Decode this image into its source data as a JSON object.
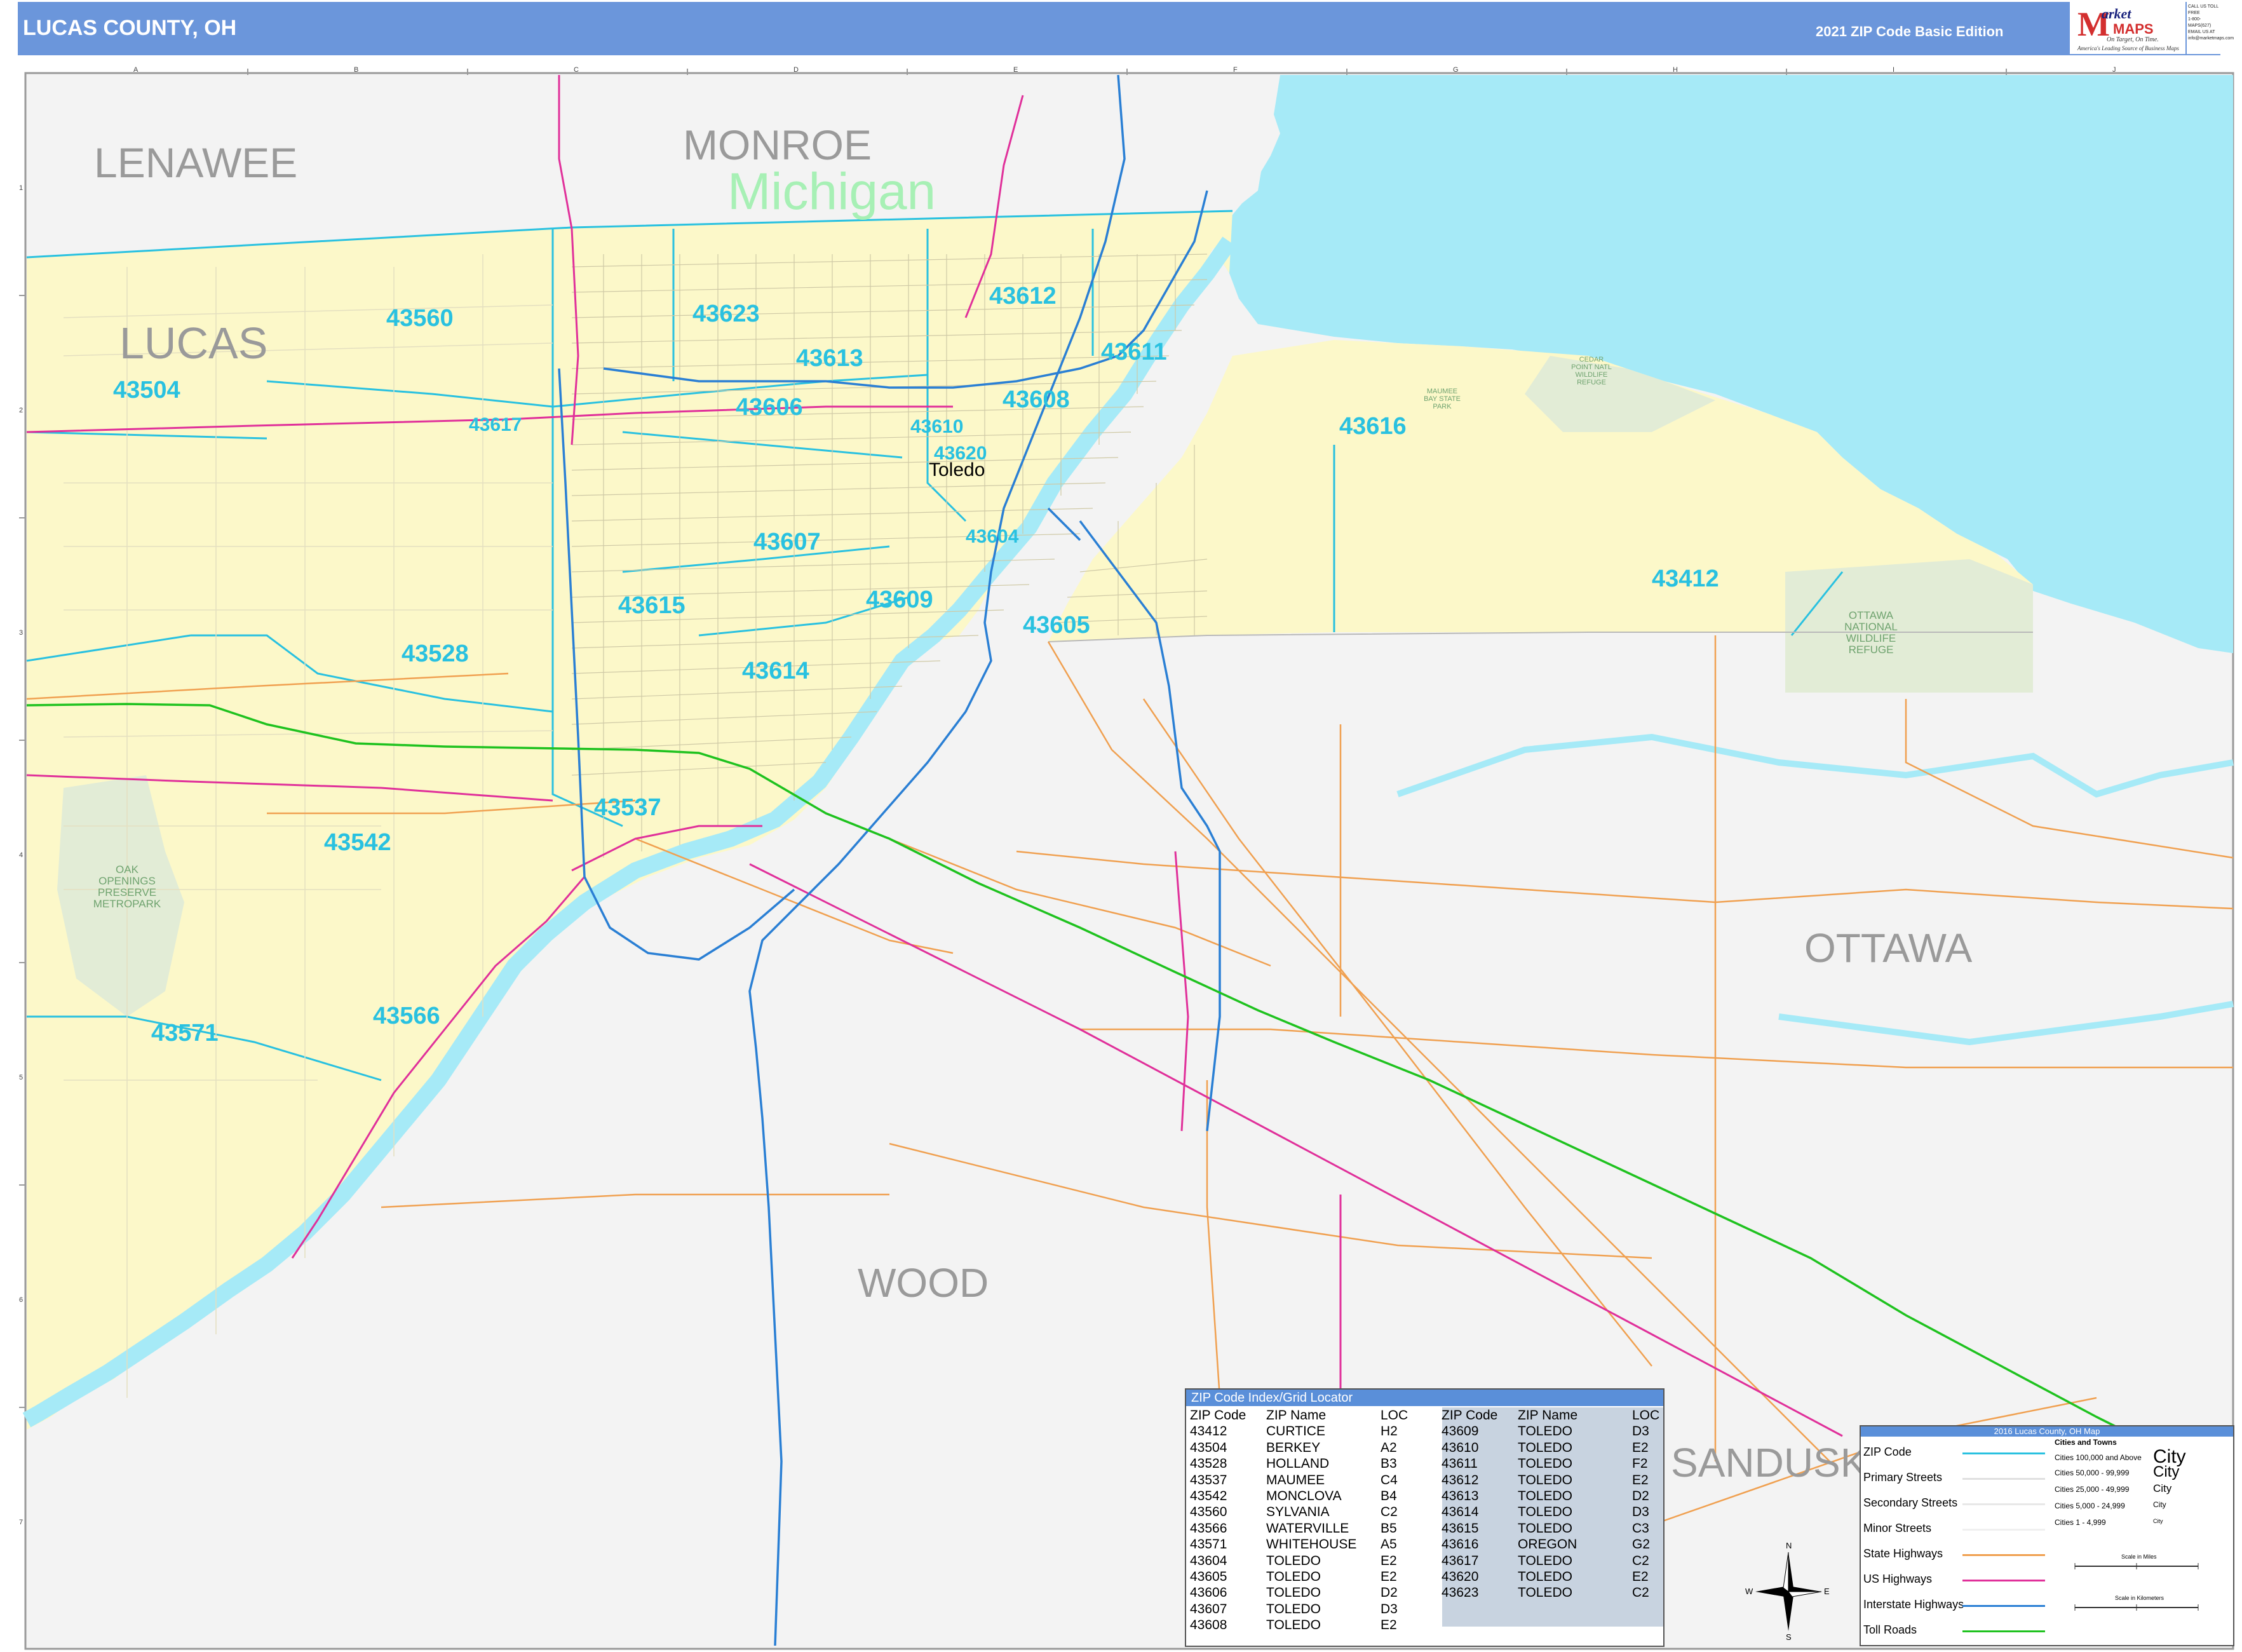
{
  "header": {
    "title": "LUCAS COUNTY, OH",
    "edition": "2021 ZIP Code Basic Edition",
    "logo": {
      "m": "M",
      "top": "arket",
      "maps": "MAPS",
      "tagline1": "On Target, On Time.",
      "tagline2": "America's Leading Source of Business Maps"
    },
    "contact": [
      "CALL US TOLL FREE",
      "1-800-MAPS(627)",
      "EMAIL US AT",
      "info@marketmaps.com"
    ]
  },
  "grid": {
    "columns": [
      "A",
      "B",
      "C",
      "D",
      "E",
      "F",
      "G",
      "H",
      "I",
      "J"
    ],
    "rows": [
      "1",
      "2",
      "3",
      "4",
      "5",
      "6",
      "7"
    ]
  },
  "counties": {
    "lenawee": "LENAWEE",
    "monroe": "MONROE",
    "lucas": "LUCAS",
    "ottawa": "OTTAWA",
    "wood": "WOOD",
    "sandusky": "SANDUSK"
  },
  "state_label": "Michigan",
  "city_label": "Toledo",
  "zip_labels": {
    "z43560": "43560",
    "z43623": "43623",
    "z43612": "43612",
    "z43613": "43613",
    "z43611": "43611",
    "z43504": "43504",
    "z43606": "43606",
    "z43608": "43608",
    "z43617": "43617",
    "z43610": "43610",
    "z43616": "43616",
    "z43620": "43620",
    "z43607": "43607",
    "z43604": "43604",
    "z43412": "43412",
    "z43615": "43615",
    "z43609": "43609",
    "z43605": "43605",
    "z43528": "43528",
    "z43614": "43614",
    "z43537": "43537",
    "z43542": "43542",
    "z43571": "43571",
    "z43566": "43566"
  },
  "parks": {
    "oak_openings": "OAK OPENINGS PRESERVE METROPARK",
    "ottawa_nwr": "OTTAWA NATIONAL WILDLIFE REFUGE",
    "maumee_bay": "MAUMEE BAY STATE PARK",
    "cedar_point": "CEDAR POINT NATL WILDLIFE REFUGE"
  },
  "index": {
    "title": "ZIP Code Index/Grid Locator",
    "headers": {
      "zip": "ZIP Code",
      "name": "ZIP Name",
      "loc": "LOC"
    },
    "left": [
      {
        "zip": "43412",
        "name": "CURTICE",
        "loc": "H2"
      },
      {
        "zip": "43504",
        "name": "BERKEY",
        "loc": "A2"
      },
      {
        "zip": "43528",
        "name": "HOLLAND",
        "loc": "B3"
      },
      {
        "zip": "43537",
        "name": "MAUMEE",
        "loc": "C4"
      },
      {
        "zip": "43542",
        "name": "MONCLOVA",
        "loc": "B4"
      },
      {
        "zip": "43560",
        "name": "SYLVANIA",
        "loc": "C2"
      },
      {
        "zip": "43566",
        "name": "WATERVILLE",
        "loc": "B5"
      },
      {
        "zip": "43571",
        "name": "WHITEHOUSE",
        "loc": "A5"
      },
      {
        "zip": "43604",
        "name": "TOLEDO",
        "loc": "E2"
      },
      {
        "zip": "43605",
        "name": "TOLEDO",
        "loc": "E2"
      },
      {
        "zip": "43606",
        "name": "TOLEDO",
        "loc": "D2"
      },
      {
        "zip": "43607",
        "name": "TOLEDO",
        "loc": "D3"
      },
      {
        "zip": "43608",
        "name": "TOLEDO",
        "loc": "E2"
      }
    ],
    "right": [
      {
        "zip": "43609",
        "name": "TOLEDO",
        "loc": "D3"
      },
      {
        "zip": "43610",
        "name": "TOLEDO",
        "loc": "E2"
      },
      {
        "zip": "43611",
        "name": "TOLEDO",
        "loc": "F2"
      },
      {
        "zip": "43612",
        "name": "TOLEDO",
        "loc": "E2"
      },
      {
        "zip": "43613",
        "name": "TOLEDO",
        "loc": "D2"
      },
      {
        "zip": "43614",
        "name": "TOLEDO",
        "loc": "D3"
      },
      {
        "zip": "43615",
        "name": "TOLEDO",
        "loc": "C3"
      },
      {
        "zip": "43616",
        "name": "OREGON",
        "loc": "G2"
      },
      {
        "zip": "43617",
        "name": "TOLEDO",
        "loc": "C2"
      },
      {
        "zip": "43620",
        "name": "TOLEDO",
        "loc": "E2"
      },
      {
        "zip": "43623",
        "name": "TOLEDO",
        "loc": "C2"
      }
    ]
  },
  "legend": {
    "title": "2016 Lucas County, OH Map",
    "items": [
      "ZIP Code",
      "Primary Streets",
      "Secondary Streets",
      "Minor Streets",
      "State Highways",
      "US Highways",
      "Interstate Highways",
      "Toll Roads"
    ],
    "colors": [
      "#29c1e0",
      "#e0e0e0",
      "#e8e8e8",
      "#f0f0f0",
      "#f0a050",
      "#e0309a",
      "#2a7fd4",
      "#1fc21f"
    ],
    "cities_title": "Cities and Towns",
    "cities": [
      {
        "range": "Cities 100,000 and Above",
        "sample": "City"
      },
      {
        "range": "Cities 50,000 - 99,999",
        "sample": "City"
      },
      {
        "range": "Cities 25,000 - 49,999",
        "sample": "City"
      },
      {
        "range": "Cities 5,000 - 24,999",
        "sample": "City"
      },
      {
        "range": "Cities 1 - 4,999",
        "sample": "City"
      }
    ],
    "scale_miles": "Scale in Miles",
    "scale_km": "Scale in Kilometers"
  },
  "compass": {
    "n": "N",
    "s": "S",
    "e": "E",
    "w": "W"
  }
}
